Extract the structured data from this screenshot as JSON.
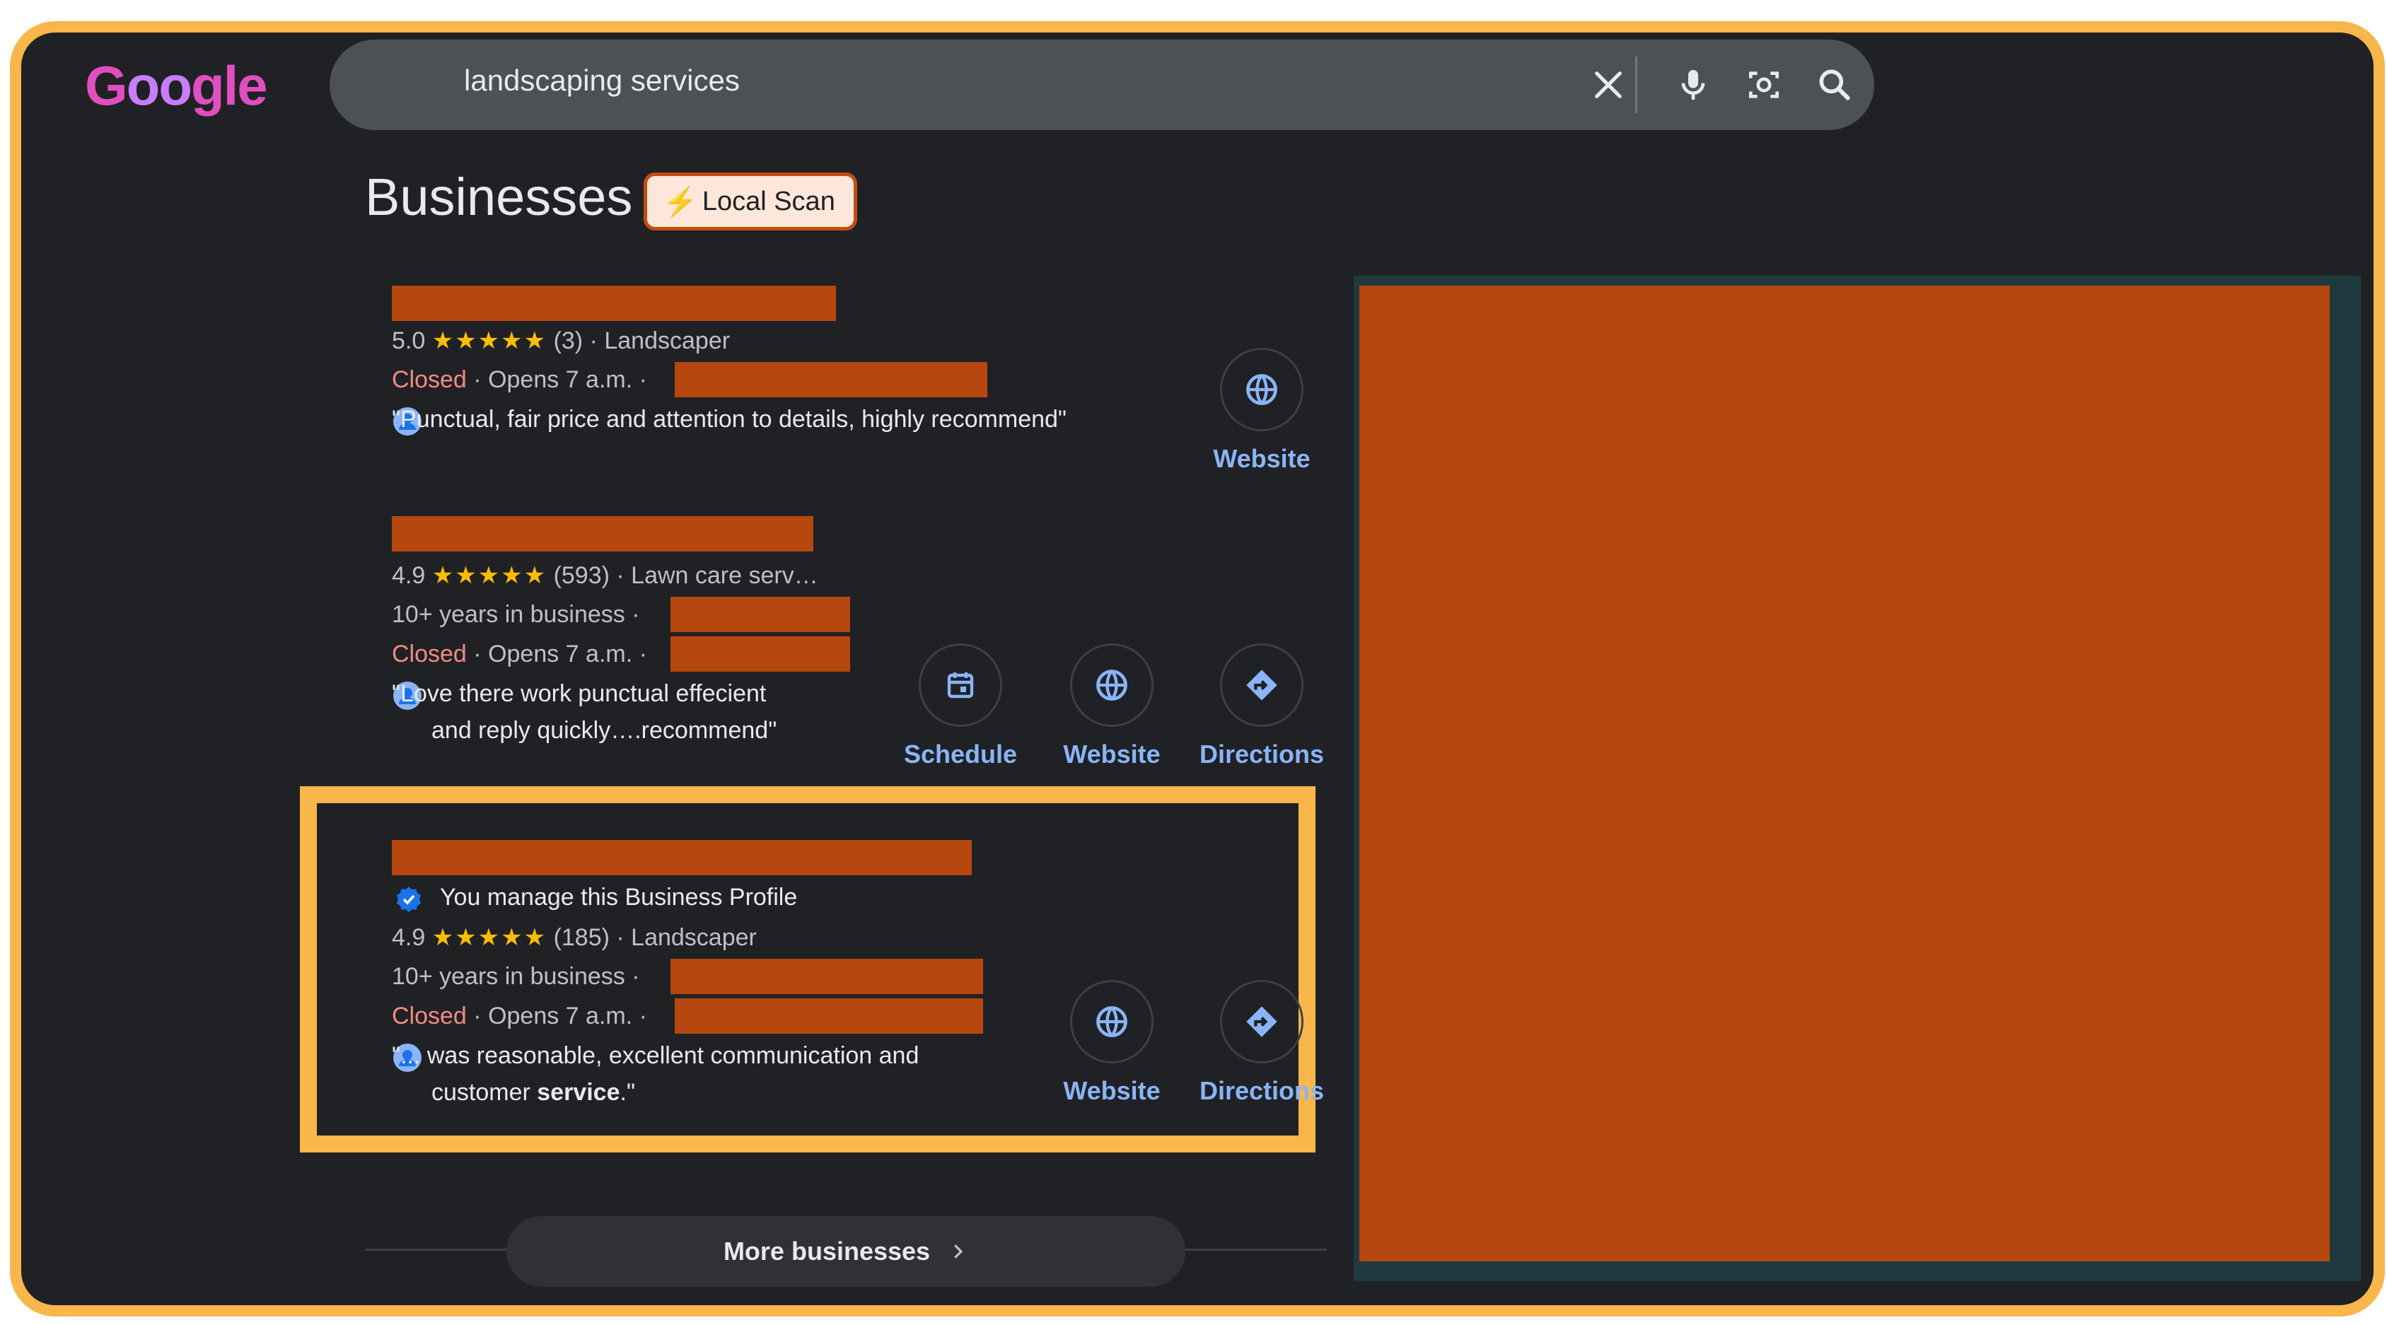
{
  "search": {
    "query": "landscaping services"
  },
  "section": {
    "title": "Businesses",
    "badge": "Local Scan"
  },
  "listings": [
    {
      "rating": "5.0",
      "stars": "★★★★★",
      "reviews": "(3)",
      "category": "· Landscaper",
      "status": "Closed",
      "hours": "· Opens 7 a.m. ·",
      "review": "\"Punctual, fair price and attention to details, highly recommend\"",
      "actions": [
        "Website"
      ]
    },
    {
      "rating": "4.9",
      "stars": "★★★★★",
      "reviews": "(593)",
      "category": "· Lawn care serv…",
      "years": "10+ years in business ·",
      "status": "Closed",
      "hours": "· Opens 7 a.m. ·",
      "review_line1": "\"Love there work punctual effecient",
      "review_line2": "and reply quickly….recommend\"",
      "actions": [
        "Schedule",
        "Website",
        "Directions"
      ]
    },
    {
      "manage": "You manage this Business Profile",
      "rating": "4.9",
      "stars": "★★★★★",
      "reviews": "(185)",
      "category": "· Landscaper",
      "years": "10+ years in business ·",
      "status": "Closed",
      "hours": "· Opens 7 a.m. ·",
      "review_line1": "\"... was reasonable, excellent communication and",
      "review_line2_pre": "customer ",
      "review_line2_bold": "service",
      "review_line2_post": ".\"",
      "actions": [
        "Website",
        "Directions"
      ]
    }
  ],
  "more": {
    "label": "More businesses"
  },
  "colors": {
    "frame": "#f9b64b",
    "redaction": "#b5470f",
    "link": "#8ab4f8",
    "closed": "#f28b82",
    "star": "#fbbc04"
  }
}
